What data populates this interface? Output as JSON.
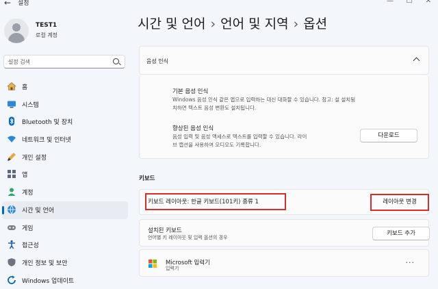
{
  "window": {
    "title": "설정",
    "controls": [
      "—",
      "☐",
      "✕"
    ]
  },
  "user": {
    "name": "TEST1",
    "account_type": "로컬 계정"
  },
  "search": {
    "placeholder": "설정 검색"
  },
  "sidebar": {
    "items": [
      {
        "label": "홈",
        "icon": "home-icon"
      },
      {
        "label": "시스템",
        "icon": "system-icon"
      },
      {
        "label": "Bluetooth 및 장치",
        "icon": "bluetooth-icon"
      },
      {
        "label": "네트워크 및 인터넷",
        "icon": "network-icon"
      },
      {
        "label": "개인 설정",
        "icon": "personalization-icon"
      },
      {
        "label": "앱",
        "icon": "apps-icon"
      },
      {
        "label": "계정",
        "icon": "accounts-icon"
      },
      {
        "label": "시간 및 언어",
        "icon": "time-language-icon",
        "active": true
      },
      {
        "label": "게임",
        "icon": "gaming-icon"
      },
      {
        "label": "접근성",
        "icon": "accessibility-icon"
      },
      {
        "label": "개인 정보 및 보안",
        "icon": "privacy-icon"
      },
      {
        "label": "Windows 업데이트",
        "icon": "windows-update-icon"
      }
    ]
  },
  "breadcrumb": [
    "시간 및 언어",
    "언어 및 지역",
    "옵션"
  ],
  "speech": {
    "title": "음성 인식",
    "basic": {
      "title": "기본 음성 인식",
      "desc_line1": "Windows 음성 인식 같은 앱으로 입력하는 대신 대화할 수 있습니다. 참고: 설      설치됨",
      "desc_line2": "치하면 텍스트 음성 변환도 설치됩니다."
    },
    "enhanced": {
      "title": "향상된 음성 인식",
      "desc_line1": "음성 입력 및 음성 액세스로 텍스트를 입력할 수 있습니다. 라이",
      "desc_line2": "브 캡션을 사용하여 오디오도 기록합니다.",
      "button": "다운로드"
    }
  },
  "keyboard": {
    "section_title": "키보드",
    "layout_label": "키보드 레이아웃: 한글 키보드(101키) 종류 1",
    "change_layout_button": "레이아웃 변경",
    "installed_title": "설치된 키보드",
    "installed_desc": "언어별 키 레이아웃 및 입력 옵션의 경우",
    "add_keyboard_button": "키보드 추가",
    "ime": {
      "name": "Microsoft 입력기",
      "type": "입력기"
    }
  },
  "colors": {
    "accent": "#0067c0",
    "highlight": "#d92b2b",
    "background": "#f3f6fb"
  }
}
